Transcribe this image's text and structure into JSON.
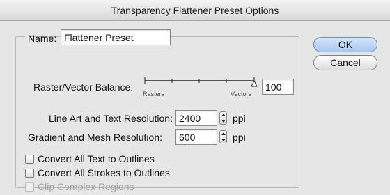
{
  "dialog": {
    "title": "Transparency Flattener Preset Options"
  },
  "name_field": {
    "label": "Name:",
    "value": "Flattener Preset"
  },
  "balance": {
    "label": "Raster/Vector Balance:",
    "left_label": "Rasters",
    "right_label": "Vectors",
    "value": "100",
    "slider_value_percent": 100
  },
  "line_art": {
    "label": "Line Art and Text Resolution:",
    "value": "2400",
    "unit": "ppi"
  },
  "gradient_mesh": {
    "label": "Gradient and Mesh Resolution:",
    "value": "600",
    "unit": "ppi"
  },
  "options": [
    {
      "label": "Convert All Text to Outlines",
      "checked": false,
      "enabled": true
    },
    {
      "label": "Convert All Strokes to Outlines",
      "checked": false,
      "enabled": true
    },
    {
      "label": "Clip Complex Regions",
      "checked": false,
      "enabled": false
    }
  ],
  "buttons": {
    "ok": "OK",
    "cancel": "Cancel"
  },
  "colors": {
    "default_button": "#a9c8ee",
    "disabled_text": "#a3a3a3"
  }
}
